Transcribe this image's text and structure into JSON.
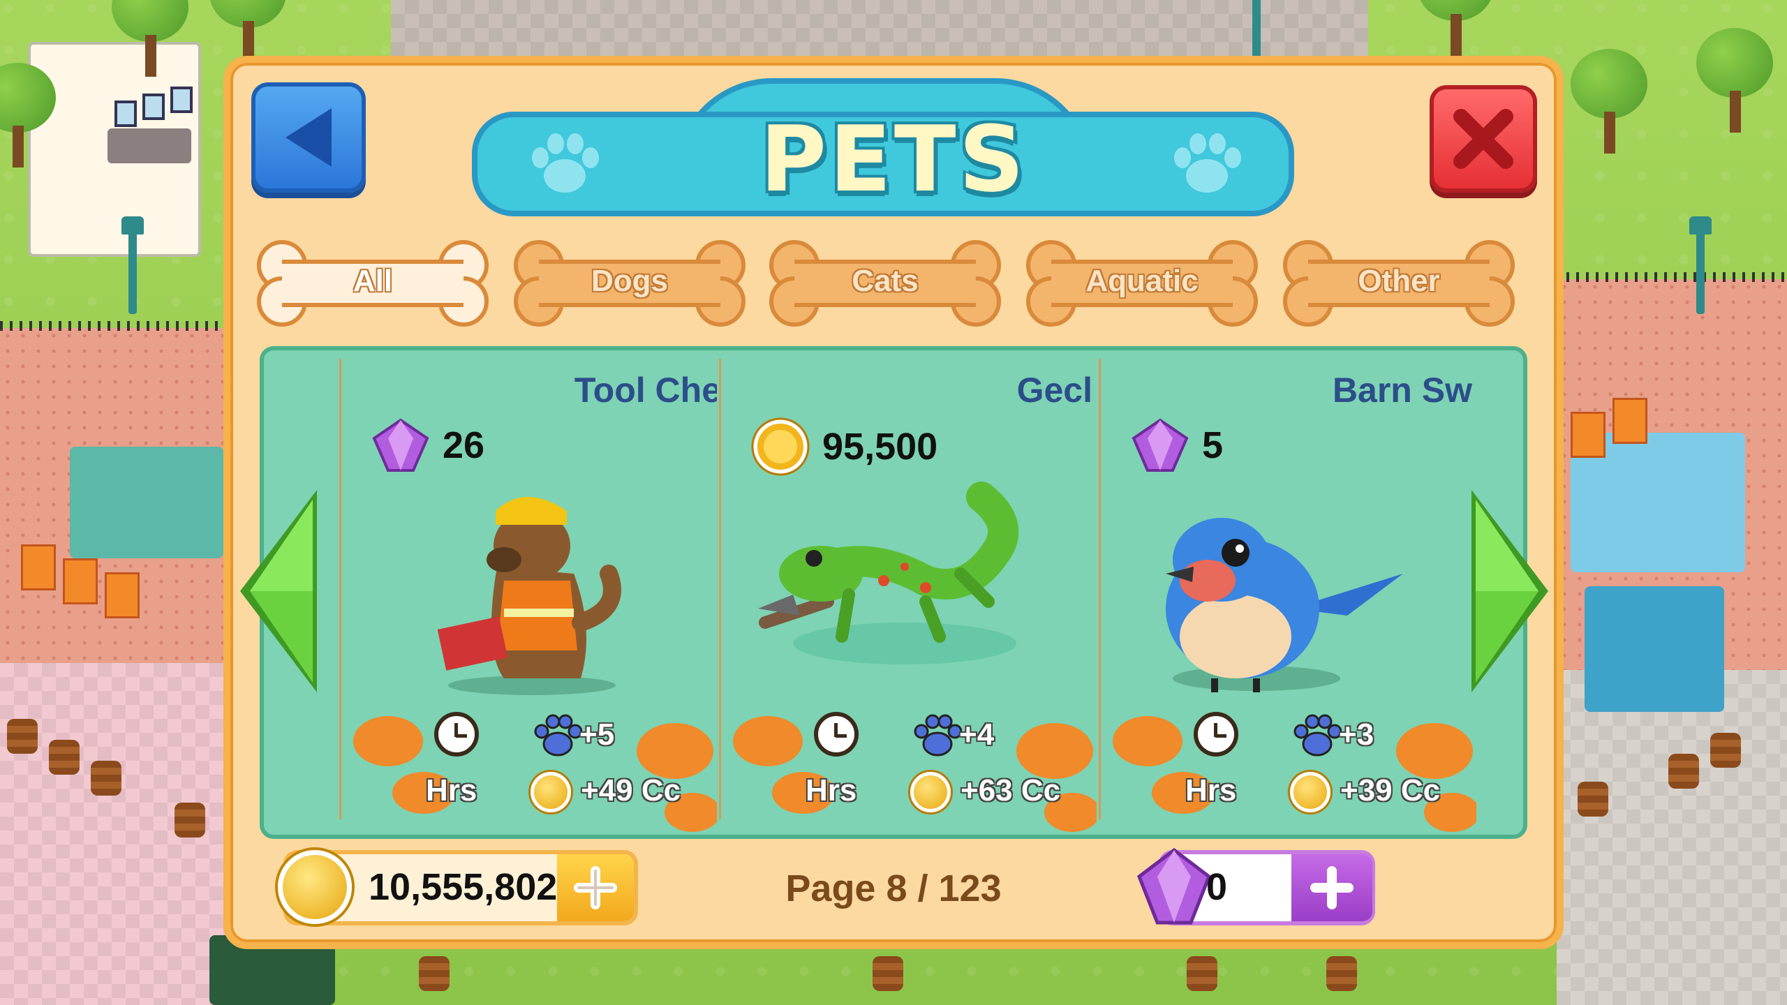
{
  "header": {
    "title": "PETS"
  },
  "nav": {
    "back": "back",
    "close": "close"
  },
  "tabs": [
    {
      "label": "All",
      "active": true
    },
    {
      "label": "Dogs",
      "active": false
    },
    {
      "label": "Cats",
      "active": false
    },
    {
      "label": "Aquatic",
      "active": false
    },
    {
      "label": "Other",
      "active": false
    }
  ],
  "pets": [
    {
      "name": "Tool Che",
      "currency": "gem",
      "price": "26",
      "time": "Hrs",
      "paw_bonus": "+5",
      "coin_bonus": "+49 Cc"
    },
    {
      "name": "Gecl",
      "currency": "coin",
      "price": "95,500",
      "time": "Hrs",
      "paw_bonus": "+4",
      "coin_bonus": "+63 Cc"
    },
    {
      "name": "Barn Sw",
      "currency": "gem",
      "price": "5",
      "time": "Hrs",
      "paw_bonus": "+3",
      "coin_bonus": "+39 Cc"
    }
  ],
  "footer": {
    "coins": "10,555,802",
    "page": "Page 8 / 123",
    "gems": "0"
  },
  "icons": [
    "paw-icon",
    "back-arrow-icon",
    "close-x-icon",
    "gem-icon",
    "coin-icon",
    "clock-icon",
    "blue-paw-icon",
    "plus-icon",
    "left-arrow-icon",
    "right-arrow-icon"
  ],
  "colors": {
    "panel": "#fcd9a0",
    "banner": "#40c8dc",
    "content": "#7dd3b3",
    "close": "#e63035",
    "back": "#2b77d9",
    "arrow": "#5cc93a"
  }
}
